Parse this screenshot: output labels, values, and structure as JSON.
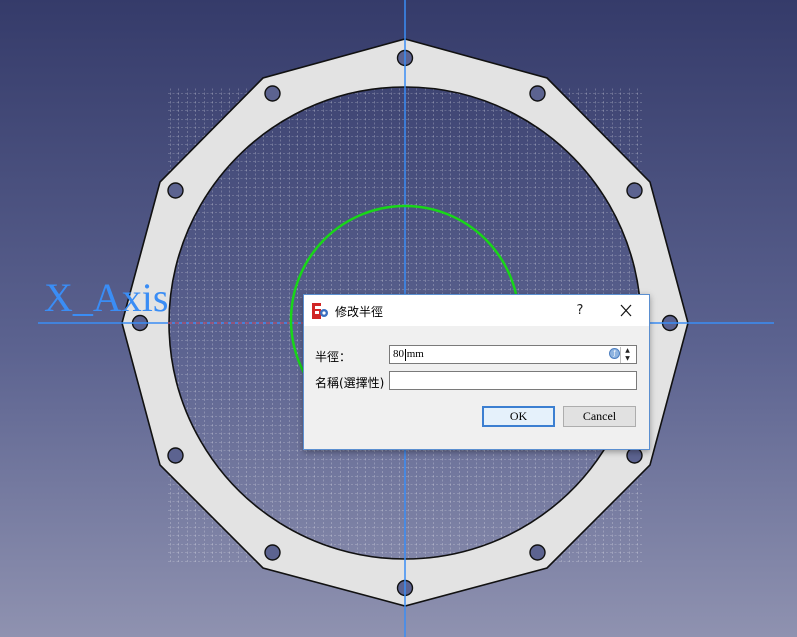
{
  "viewport": {
    "axis_label": "X_Axis",
    "colors": {
      "background_top": "#353b6a",
      "background_bottom": "#8f92b0",
      "flange_fill": "#e3e3e3",
      "axis_blue": "#3a8df5",
      "sketch_circle": "#19d619",
      "grid": "#ffffff",
      "x_axis_dashed": "#e03030"
    }
  },
  "dialog": {
    "icon": "freecad-app-icon",
    "title": "修改半徑",
    "help_label": "?",
    "close_icon": "close-icon",
    "radius_label": "半徑：",
    "radius_value": "80 mm",
    "expression_icon": "expression-binding-icon",
    "spin_up_icon": "spin-up-icon",
    "spin_down_icon": "spin-down-icon",
    "name_label": "名稱(選擇性)",
    "name_value": "",
    "ok_label": "OK",
    "cancel_label": "Cancel"
  }
}
